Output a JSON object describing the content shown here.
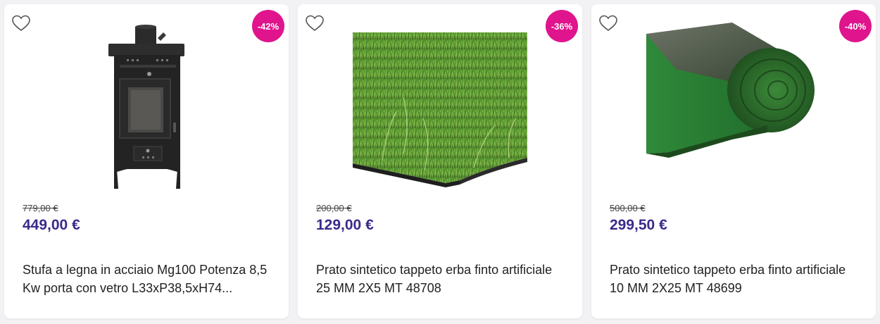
{
  "colors": {
    "badge": "#e0148c",
    "price": "#3a2a8c",
    "heart": "#555555"
  },
  "products": [
    {
      "discount": "-42%",
      "old_price": "779,00 €",
      "price": "449,00 €",
      "title": "Stufa a legna in acciaio Mg100 Potenza 8,5 Kw porta con vetro L33xP38,5xH74...",
      "image": "wood-stove"
    },
    {
      "discount": "-36%",
      "old_price": "200,00 €",
      "price": "129,00 €",
      "title": "Prato sintetico tappeto erba finto artificiale 25 MM 2X5 MT 48708",
      "image": "artificial-grass-tile"
    },
    {
      "discount": "-40%",
      "old_price": "500,00 €",
      "price": "299,50 €",
      "title": "Prato sintetico tappeto erba finto artificiale 10 MM 2X25 MT 48699",
      "image": "artificial-grass-roll"
    }
  ]
}
